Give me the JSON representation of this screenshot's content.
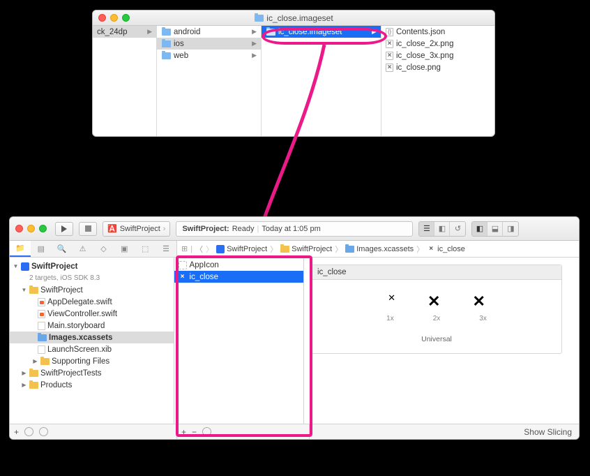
{
  "finder": {
    "title": "ic_close.imageset",
    "col0": {
      "items": [
        {
          "label": "ck_24dp"
        }
      ]
    },
    "col1": {
      "items": [
        {
          "label": "android"
        },
        {
          "label": "ios"
        },
        {
          "label": "web"
        }
      ]
    },
    "col2": {
      "items": [
        {
          "label": "ic_close.imageset"
        }
      ]
    },
    "col3": {
      "items": [
        {
          "label": "Contents.json"
        },
        {
          "label": "ic_close_2x.png"
        },
        {
          "label": "ic_close_3x.png"
        },
        {
          "label": "ic_close.png"
        }
      ]
    }
  },
  "xcode": {
    "scheme": "SwiftProject",
    "status": {
      "title": "SwiftProject:",
      "state": "Ready",
      "sep": "|",
      "time": "Today at 1:05 pm"
    },
    "jumpbar": [
      "SwiftProject",
      "SwiftProject",
      "Images.xcassets",
      "ic_close"
    ],
    "navigator": {
      "project": "SwiftProject",
      "subtitle": "2 targets, iOS SDK 8.3",
      "group1": "SwiftProject",
      "files": [
        "AppDelegate.swift",
        "ViewController.swift",
        "Main.storyboard",
        "Images.xcassets",
        "LaunchScreen.xib"
      ],
      "supporting": "Supporting Files",
      "tests": "SwiftProjectTests",
      "products": "Products"
    },
    "assets": {
      "items": [
        {
          "label": "AppIcon"
        },
        {
          "label": "ic_close"
        }
      ]
    },
    "canvas": {
      "title": "ic_close",
      "labels": [
        "1x",
        "2x",
        "3x"
      ],
      "universal": "Universal"
    },
    "footer": {
      "plus": "+",
      "minus": "−",
      "slicing": "Show Slicing"
    }
  }
}
